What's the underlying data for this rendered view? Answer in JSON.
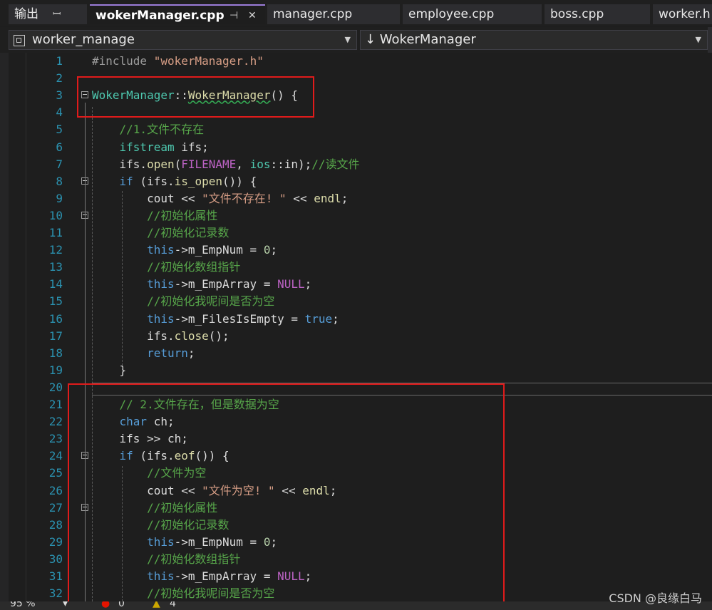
{
  "tabs": [
    {
      "label": "输出",
      "pin": "ꟷ"
    },
    {
      "label": "wokerManager.cpp",
      "pin": "⊣",
      "close": "✕"
    },
    {
      "label": "manager.cpp"
    },
    {
      "label": "employee.cpp"
    },
    {
      "label": "boss.cpp"
    },
    {
      "label": "worker.h"
    }
  ],
  "nav": {
    "project": "worker_manage",
    "member": "↓ WokerManager"
  },
  "code_lines": [
    [
      "1",
      "<span class='inc'>#include</span> <span class='st'>\"wokerManager.h\"</span>"
    ],
    [
      "2",
      ""
    ],
    [
      "3",
      "<span class='ty'>WokerManager</span>::<span class='fn squig'>WokerManager</span>() {"
    ],
    [
      "4",
      ""
    ],
    [
      "5",
      "    <span class='cm'>//1.文件不存在</span>"
    ],
    [
      "6",
      "    <span class='ty'>ifstream</span> ifs;"
    ],
    [
      "7",
      "    ifs.<span class='fn'>open</span>(<span class='mac'>FILENAME</span>, <span class='ty'>ios</span>::in);<span class='cm'>//读文件</span>"
    ],
    [
      "8",
      "    <span class='kw'>if</span> (ifs.<span class='fn'>is_open</span>()) {"
    ],
    [
      "9",
      "        cout &lt;&lt; <span class='st'>\"文件不存在! \"</span> &lt;&lt; <span class='fn'>endl</span>;"
    ],
    [
      "10",
      "        <span class='cm'>//初始化属性</span>"
    ],
    [
      "11",
      "        <span class='cm'>//初始化记录数</span>"
    ],
    [
      "12",
      "        <span class='kw'>this</span>-&gt;m_EmpNum = <span class='num'>0</span>;"
    ],
    [
      "13",
      "        <span class='cm'>//初始化数组指针</span>"
    ],
    [
      "14",
      "        <span class='kw'>this</span>-&gt;m_EmpArray = <span class='mac'>NULL</span>;"
    ],
    [
      "15",
      "        <span class='cm'>//初始化我呢间是否为空</span>"
    ],
    [
      "16",
      "        <span class='kw'>this</span>-&gt;m_FilesIsEmpty = <span class='kw'>true</span>;"
    ],
    [
      "17",
      "        ifs.<span class='fn'>close</span>();"
    ],
    [
      "18",
      "        <span class='kw'>return</span>;"
    ],
    [
      "19",
      "    }"
    ],
    [
      "20",
      ""
    ],
    [
      "21",
      "    <span class='cm'>// 2.文件存在，但是数据为空</span>"
    ],
    [
      "22",
      "    <span class='kw'>char</span> ch;"
    ],
    [
      "23",
      "    ifs &gt;&gt; ch;"
    ],
    [
      "24",
      "    <span class='kw'>if</span> (ifs.<span class='fn'>eof</span>()) {"
    ],
    [
      "25",
      "        <span class='cm'>//文件为空</span>"
    ],
    [
      "26",
      "        cout &lt;&lt; <span class='st'>\"文件为空! \"</span> &lt;&lt; <span class='fn'>endl</span>;"
    ],
    [
      "27",
      "        <span class='cm'>//初始化属性</span>"
    ],
    [
      "28",
      "        <span class='cm'>//初始化记录数</span>"
    ],
    [
      "29",
      "        <span class='kw'>this</span>-&gt;m_EmpNum = <span class='num'>0</span>;"
    ],
    [
      "30",
      "        <span class='cm'>//初始化数组指针</span>"
    ],
    [
      "31",
      "        <span class='kw'>this</span>-&gt;m_EmpArray = <span class='mac'>NULL</span>;"
    ],
    [
      "32",
      "        <span class='cm'>//初始化我呢间是否为空</span>"
    ]
  ],
  "status": {
    "zoom": "95 %",
    "errors": "0",
    "warnings": "4"
  },
  "watermark": "CSDN @良缘白马"
}
